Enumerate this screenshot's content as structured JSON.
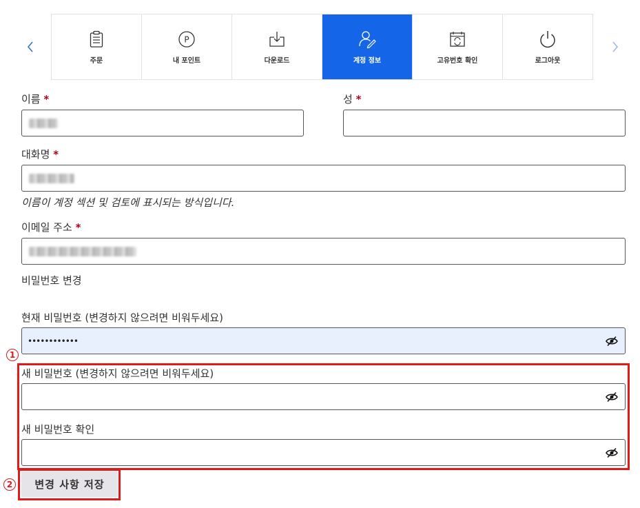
{
  "nav": {
    "tabs": [
      {
        "label": "주문",
        "icon": "clipboard-icon",
        "active": false
      },
      {
        "label": "내 포인트",
        "icon": "points-icon",
        "active": false
      },
      {
        "label": "다운로드",
        "icon": "download-icon",
        "active": false
      },
      {
        "label": "계정 정보",
        "icon": "user-edit-icon",
        "active": true
      },
      {
        "label": "고유번호 확인",
        "icon": "calendar-refresh-icon",
        "active": false
      },
      {
        "label": "로그아웃",
        "icon": "power-icon",
        "active": false
      }
    ],
    "points_glyph": "P"
  },
  "form": {
    "required_mark": "*",
    "first_name_label": "이름",
    "last_name_label": "성",
    "last_name_value": "",
    "display_name_label": "대화명",
    "display_name_help": "이름이 계정 섹션 및 검토에 표시되는 방식입니다.",
    "email_label": "이메일 주소",
    "password_section_title": "비밀번호 변경",
    "current_password_label": "현재 비밀번호 (변경하지 않으려면 비워두세요)",
    "current_password_value": "••••••••••••",
    "new_password_label": "새 비밀번호 (변경하지 않으려면 비워두세요)",
    "new_password_value": "",
    "confirm_password_label": "새 비밀번호 확인",
    "confirm_password_value": "",
    "save_button": "변경 사항 저장"
  },
  "annotations": {
    "marker_1": "1",
    "marker_2": "2",
    "highlight_color": "#e0191b"
  },
  "colors": {
    "accent": "#1565e8",
    "required": "#b3001b"
  }
}
